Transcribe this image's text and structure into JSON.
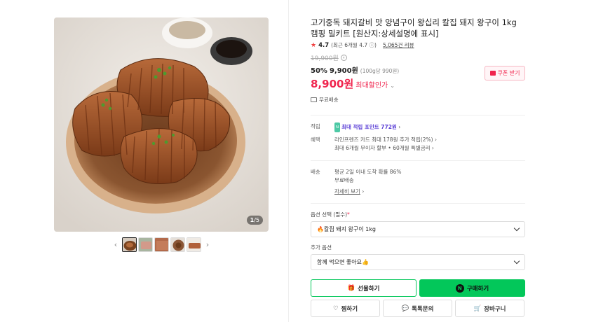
{
  "gallery": {
    "page_current": "1",
    "page_total": "5",
    "thumbnails": [
      "thumb-pork-dish",
      "thumb-raw-meat",
      "thumb-grilled-meat",
      "thumb-plated-dish",
      "thumb-packaged-meat"
    ]
  },
  "product": {
    "title": "고기중독 돼지갈비 맛 양념구이 왕십리 칼집 돼지 왕구이 1kg 캠핑 밀키트 [원산지:상세설명에 표시]",
    "rating": "4.7",
    "rating_recent": "(최근 6개월 4.7",
    "review_count": "5,065건 리뷰",
    "original_price": "19,900원",
    "discount_rate": "50%",
    "sale_price": "9,900원",
    "unit_price": "(100g당 990원)",
    "max_discount_price": "8,900원",
    "max_discount_label": "최대할인가",
    "coupon_button": "쿠폰 받기",
    "shipping_short": "무료배송"
  },
  "benefits": {
    "points_label": "적립",
    "points_badge": "N",
    "points_text": "최대 적립 포인트 772원",
    "benefit_label": "혜택",
    "benefit_line1": "라인프렌즈 카드 최대 178원 추가 적립(2%)",
    "benefit_line2": "최대 6개월 무이자 할부 • 60개월 특별금리",
    "delivery_label": "배송",
    "delivery_line1": "평균 2일 이내 도착 확률 86%",
    "delivery_line2": "무료배송",
    "delivery_more": "자세히 보기"
  },
  "options": {
    "required_label": "옵션 선택 (필수)",
    "required_mark": "*",
    "required_value": "🔥칼집 돼지 왕구이 1kg",
    "extra_label": "추가 옵션",
    "extra_value": "함께 먹으면 좋아요👍"
  },
  "actions": {
    "gift": "선물하기",
    "buy": "구매하기",
    "wish": "찜하기",
    "talk": "톡톡문의",
    "cart": "장바구니"
  },
  "colors": {
    "accent_green": "#03c75a",
    "price_red": "#f0254e",
    "points_purple": "#5b3fd6"
  }
}
